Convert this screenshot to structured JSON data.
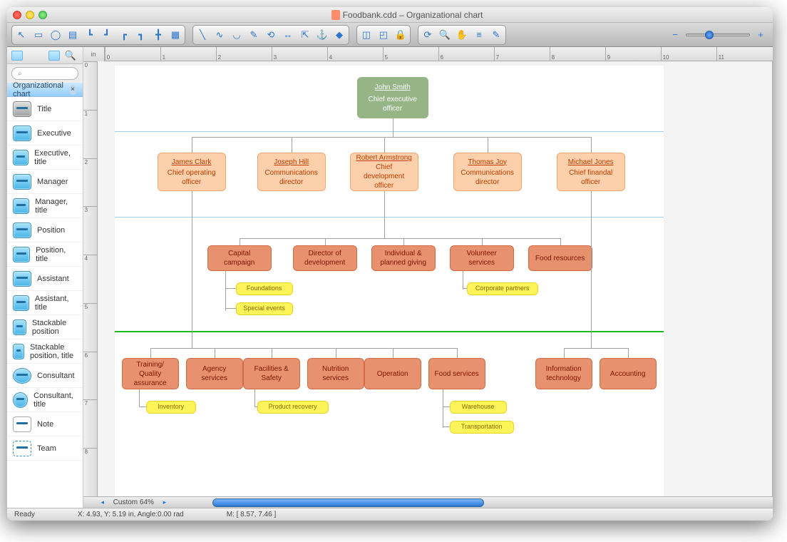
{
  "window": {
    "title": "Foodbank.cdd – Organizational chart"
  },
  "sidebar": {
    "category_label": "Organizational chart",
    "search_placeholder": "",
    "shapes": [
      "Title",
      "Executive",
      "Executive, title",
      "Manager",
      "Manager, title",
      "Position",
      "Position, title",
      "Assistant",
      "Assistant, title",
      "Stackable position",
      "Stackable position, title",
      "Consultant",
      "Consultant, title",
      "Note",
      "Team"
    ]
  },
  "toolbar_icons": {
    "arrow": "↖",
    "rect": "▭",
    "oval": "◯",
    "grid": "▤",
    "connect1": "┗",
    "connect2": "┛",
    "connect3": "┏",
    "connect4": "┓",
    "connect5": "╋",
    "newpage": "▦",
    "line": "╲",
    "curve": "∿",
    "arc": "◡",
    "scribble": "✎",
    "edit1": "⟲",
    "dim": "↔",
    "resize": "⇱",
    "anchor": "⚓",
    "node": "◆",
    "sel1": "◫",
    "sel2": "◰",
    "lock": "🔒",
    "refresh": "⟳",
    "zoom": "🔍",
    "hand": "✋",
    "snap": "≡",
    "eyedrop": "✎",
    "zoomout": "−",
    "zoomin": "+"
  },
  "ruler_unit": "in",
  "zoom": "Custom 64%",
  "status": {
    "ready": "Ready",
    "coords": "X: 4.93, Y: 5.19 in, Angle:0.00 rad",
    "m": "M: [ 8.57, 7.46 ]"
  },
  "chart_data": {
    "type": "org-chart",
    "root": {
      "name": "John Smith",
      "title": "Chief executive officer",
      "kind": "ceo"
    },
    "level2": [
      {
        "name": "James Clark",
        "title": "Chief operating officer"
      },
      {
        "name": "Joseph Hill",
        "title": "Communications director"
      },
      {
        "name": "Robert Armstrong",
        "title": "Chief development officer"
      },
      {
        "name": "Thomas Joy",
        "title": "Communications director"
      },
      {
        "name": "Michael Jones",
        "title": "Chief finandal officer"
      }
    ],
    "level3": [
      {
        "label": "Capital campaign"
      },
      {
        "label": "Director of development"
      },
      {
        "label": "Individual & planned giving"
      },
      {
        "label": "Volunteer services"
      },
      {
        "label": "Food resources"
      }
    ],
    "level3_leaves": [
      {
        "parent": "Capital campaign",
        "label": "Foundations"
      },
      {
        "parent": "Capital campaign",
        "label": "Special events"
      },
      {
        "parent": "Volunteer services",
        "label": "Corporate partners"
      }
    ],
    "level4": [
      {
        "label": "Training/ Quality assurance"
      },
      {
        "label": "Agency services"
      },
      {
        "label": "Facilities & Safety"
      },
      {
        "label": "Nutrition services"
      },
      {
        "label": "Operation"
      },
      {
        "label": "Food services"
      },
      {
        "label": "Information technology"
      },
      {
        "label": "Accounting"
      }
    ],
    "level4_leaves": [
      {
        "parent": "Training/ Quality assurance",
        "label": "Inventory"
      },
      {
        "parent": "Facilities & Safety",
        "label": "Product recovery"
      },
      {
        "parent": "Food services",
        "label": "Warehouse"
      },
      {
        "parent": "Food services",
        "label": "Transportation"
      }
    ]
  }
}
